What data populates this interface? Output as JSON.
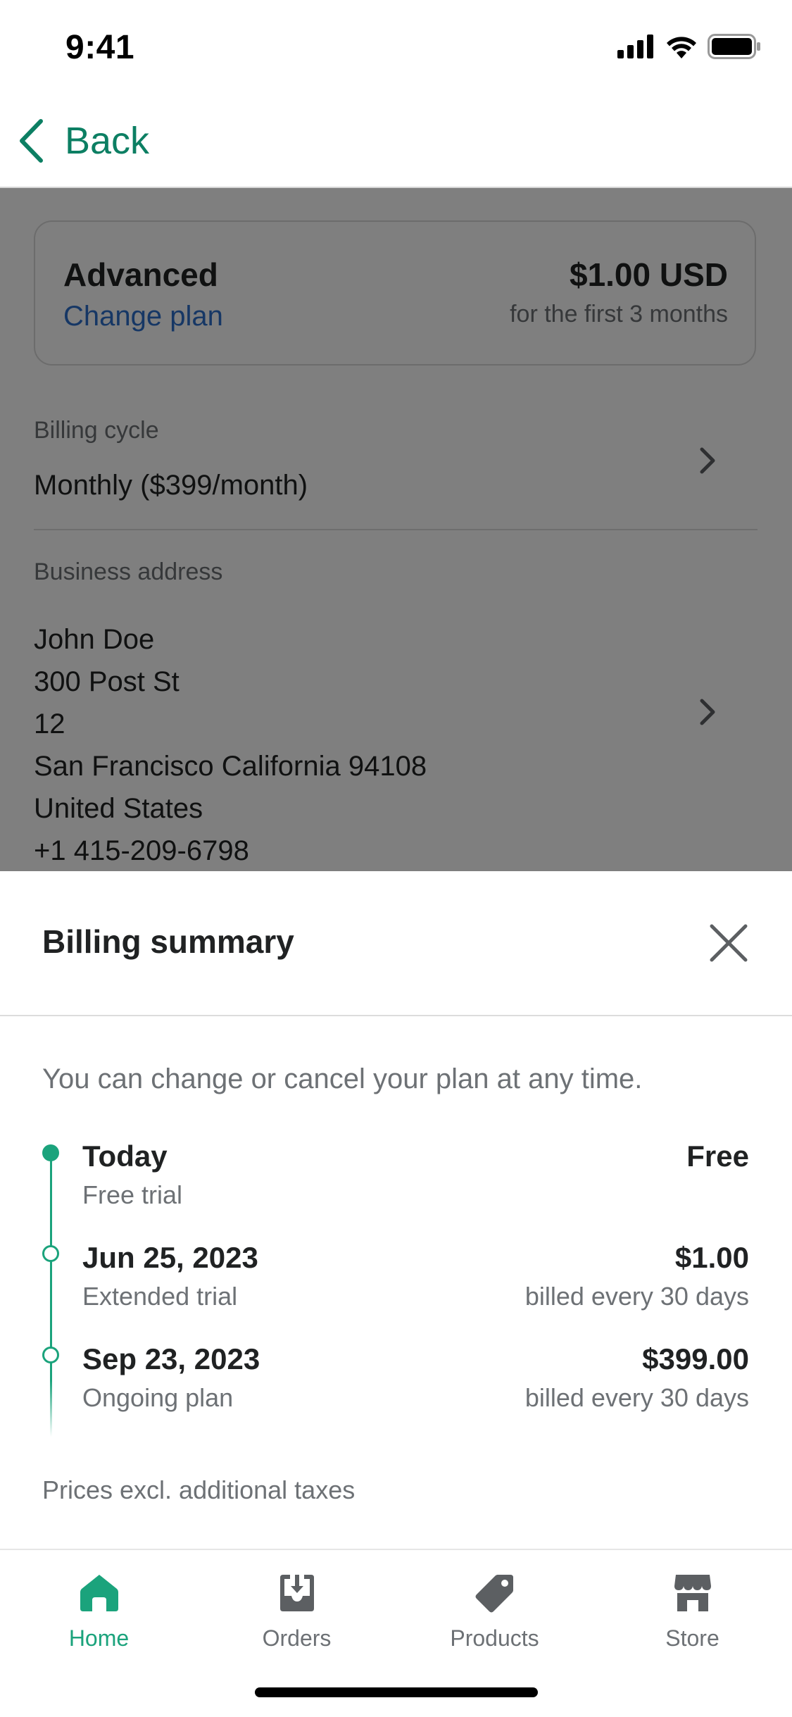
{
  "status_bar": {
    "time": "9:41"
  },
  "header": {
    "back_label": "Back"
  },
  "plan_card": {
    "plan_name": "Advanced",
    "change_plan_label": "Change plan",
    "price": "$1.00 USD",
    "price_note": "for the first 3 months"
  },
  "billing_cycle": {
    "label": "Billing cycle",
    "value": "Monthly ($399/month)"
  },
  "business_address": {
    "label": "Business address",
    "lines": [
      "John Doe",
      "300 Post St",
      "12",
      "San Francisco California 94108",
      "United States",
      "+1 415-209-6798"
    ]
  },
  "billing_summary": {
    "title": "Billing summary",
    "description": "You can change or cancel your plan at any time.",
    "timeline": [
      {
        "title": "Today",
        "subtitle": "Free trial",
        "price": "Free",
        "price_note": ""
      },
      {
        "title": "Jun 25, 2023",
        "subtitle": "Extended trial",
        "price": "$1.00",
        "price_note": "billed every 30 days"
      },
      {
        "title": "Sep 23, 2023",
        "subtitle": "Ongoing plan",
        "price": "$399.00",
        "price_note": "billed every 30 days"
      }
    ],
    "tax_note": "Prices excl. additional taxes"
  },
  "tabbar": {
    "tabs": [
      {
        "label": "Home",
        "icon": "home-icon",
        "active": true
      },
      {
        "label": "Orders",
        "icon": "orders-icon",
        "active": false
      },
      {
        "label": "Products",
        "icon": "tag-icon",
        "active": false
      },
      {
        "label": "Store",
        "icon": "store-icon",
        "active": false
      }
    ]
  },
  "colors": {
    "accent_green": "#1ba37c",
    "back_green": "#0c7f63",
    "link_blue": "#2c6ecb",
    "overlay": "rgba(0,0,0,0.5)"
  }
}
